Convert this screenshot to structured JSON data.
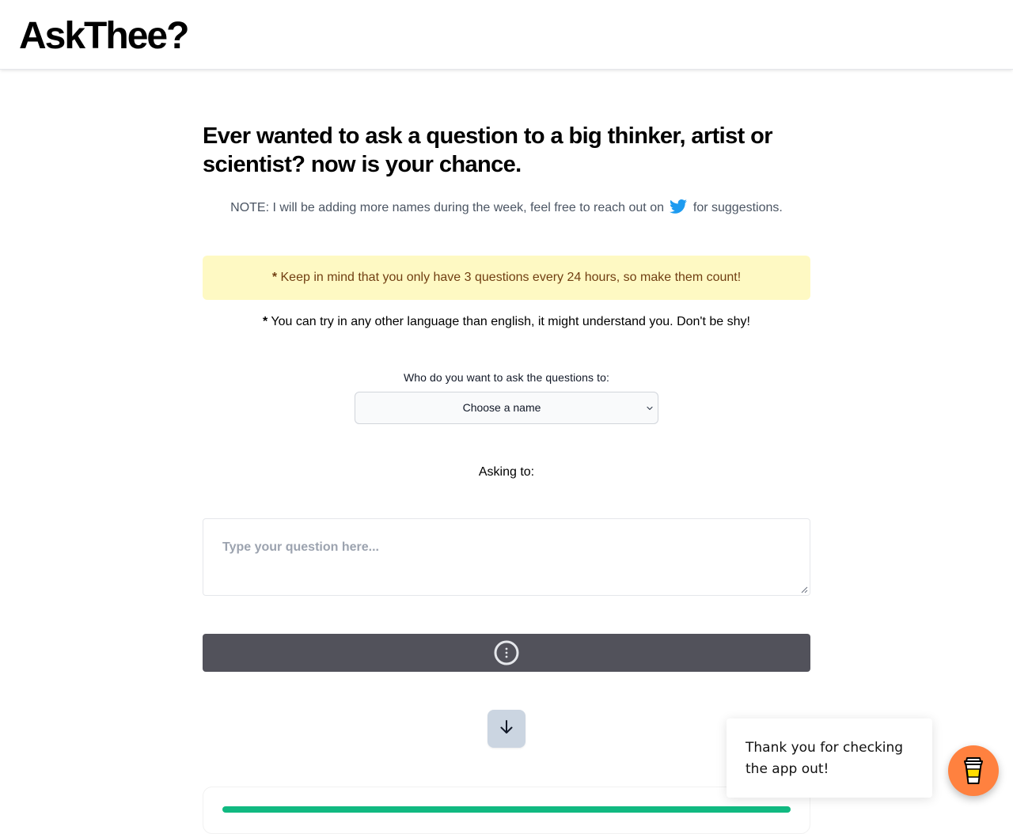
{
  "header": {
    "logo": "AskThee?"
  },
  "main": {
    "headline": "Ever wanted to ask a question to a big thinker, artist or scientist? now is your chance.",
    "note_before": "NOTE: I will be adding more names during the week, feel free to reach out on",
    "note_after": "for suggestions.",
    "warning": {
      "asterisk": "*",
      "text": "Keep in mind that you only have 3 questions every 24 hours, so make them count!"
    },
    "language_note": {
      "asterisk": "*",
      "text": "You can try in any other language than english, it might understand you. Don't be shy!"
    },
    "select_label": "Who do you want to ask the questions to:",
    "select_value": "Choose a name",
    "asking_to": "Asking to:",
    "question_placeholder": "Type your question here..."
  },
  "popup": {
    "text": "Thank you for checking the app out!"
  },
  "icons": {
    "twitter": "twitter-icon",
    "chevron": "chevron-down-icon",
    "spinner": "spinner-icon",
    "scroll_down": "arrow-down-icon",
    "coffee": "coffee-cup-icon"
  },
  "colors": {
    "twitter_blue": "#1d9bf0",
    "warning_bg": "#fef9c3",
    "warning_text": "#713f12",
    "submit_bg": "#52525b",
    "scroll_button_bg": "#cbd5e1",
    "progress_green": "#10b981",
    "coffee_orange": "#ff813f"
  }
}
